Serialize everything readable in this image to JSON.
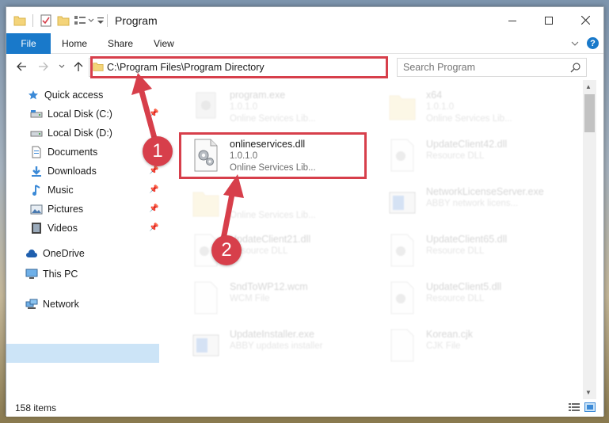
{
  "window": {
    "title": "Program"
  },
  "ribbon": {
    "file_tab": "File",
    "tabs": [
      "Home",
      "Share",
      "View"
    ],
    "help_label": "?"
  },
  "nav": {
    "address": "C:\\Program Files\\Program Directory",
    "search_placeholder": "Search Program"
  },
  "sidebar": {
    "quick_access": "Quick access",
    "items": [
      {
        "label": "Local Disk (C:)",
        "icon": "drive-icon",
        "pinned": true
      },
      {
        "label": "Local Disk (D:)",
        "icon": "drive-icon",
        "pinned": false
      },
      {
        "label": "Documents",
        "icon": "documents-icon",
        "pinned": true
      },
      {
        "label": "Downloads",
        "icon": "downloads-icon",
        "pinned": true
      },
      {
        "label": "Music",
        "icon": "music-icon",
        "pinned": true
      },
      {
        "label": "Pictures",
        "icon": "pictures-icon",
        "pinned": true
      },
      {
        "label": "Videos",
        "icon": "videos-icon",
        "pinned": true
      }
    ],
    "onedrive": "OneDrive",
    "this_pc": "This PC",
    "network": "Network"
  },
  "files": {
    "left": [
      {
        "name": "program.exe",
        "line1": "1.0.1.0",
        "line2": "Online Services Lib...",
        "icon": "exe-icon",
        "faded": true
      },
      {
        "name": "onlineservices.dll",
        "line1": "1.0.1.0",
        "line2": "Online Services Lib...",
        "icon": "dll-icon",
        "faded": false
      },
      {
        "name": "",
        "line1": "",
        "line2": "Online Services Lib...",
        "icon": "folder-icon",
        "faded": true
      },
      {
        "name": "UpdateClient21.dll",
        "line1": "Resource DLL",
        "line2": "",
        "icon": "dll-icon",
        "faded": true
      },
      {
        "name": "SndToWP12.wcm",
        "line1": "WCM File",
        "line2": "",
        "icon": "file-icon",
        "faded": true
      },
      {
        "name": "UpdateInstaller.exe",
        "line1": "ABBY updates installer",
        "line2": "",
        "icon": "app-icon",
        "faded": true
      }
    ],
    "right": [
      {
        "name": "x64",
        "line1": "1.0.1.0",
        "line2": "Online Services Lib...",
        "icon": "folder-icon",
        "faded": true
      },
      {
        "name": "UpdateClient42.dll",
        "line1": "Resource DLL",
        "line2": "",
        "icon": "dll-icon",
        "faded": true
      },
      {
        "name": "NetworkLicenseServer.exe",
        "line1": "ABBY network licens...",
        "line2": "",
        "icon": "app-icon",
        "faded": true
      },
      {
        "name": "UpdateClient65.dll",
        "line1": "Resource DLL",
        "line2": "",
        "icon": "dll-icon",
        "faded": true
      },
      {
        "name": "UpdateClient5.dll",
        "line1": "Resource DLL",
        "line2": "",
        "icon": "dll-icon",
        "faded": true
      },
      {
        "name": "Korean.cjk",
        "line1": "CJK File",
        "line2": "",
        "icon": "file-icon",
        "faded": true
      }
    ]
  },
  "status": {
    "item_count": "158 items"
  },
  "callouts": [
    "1",
    "2"
  ],
  "colors": {
    "accent": "#1979ca",
    "highlight": "#d73f4b",
    "selection": "#cce4f7"
  }
}
